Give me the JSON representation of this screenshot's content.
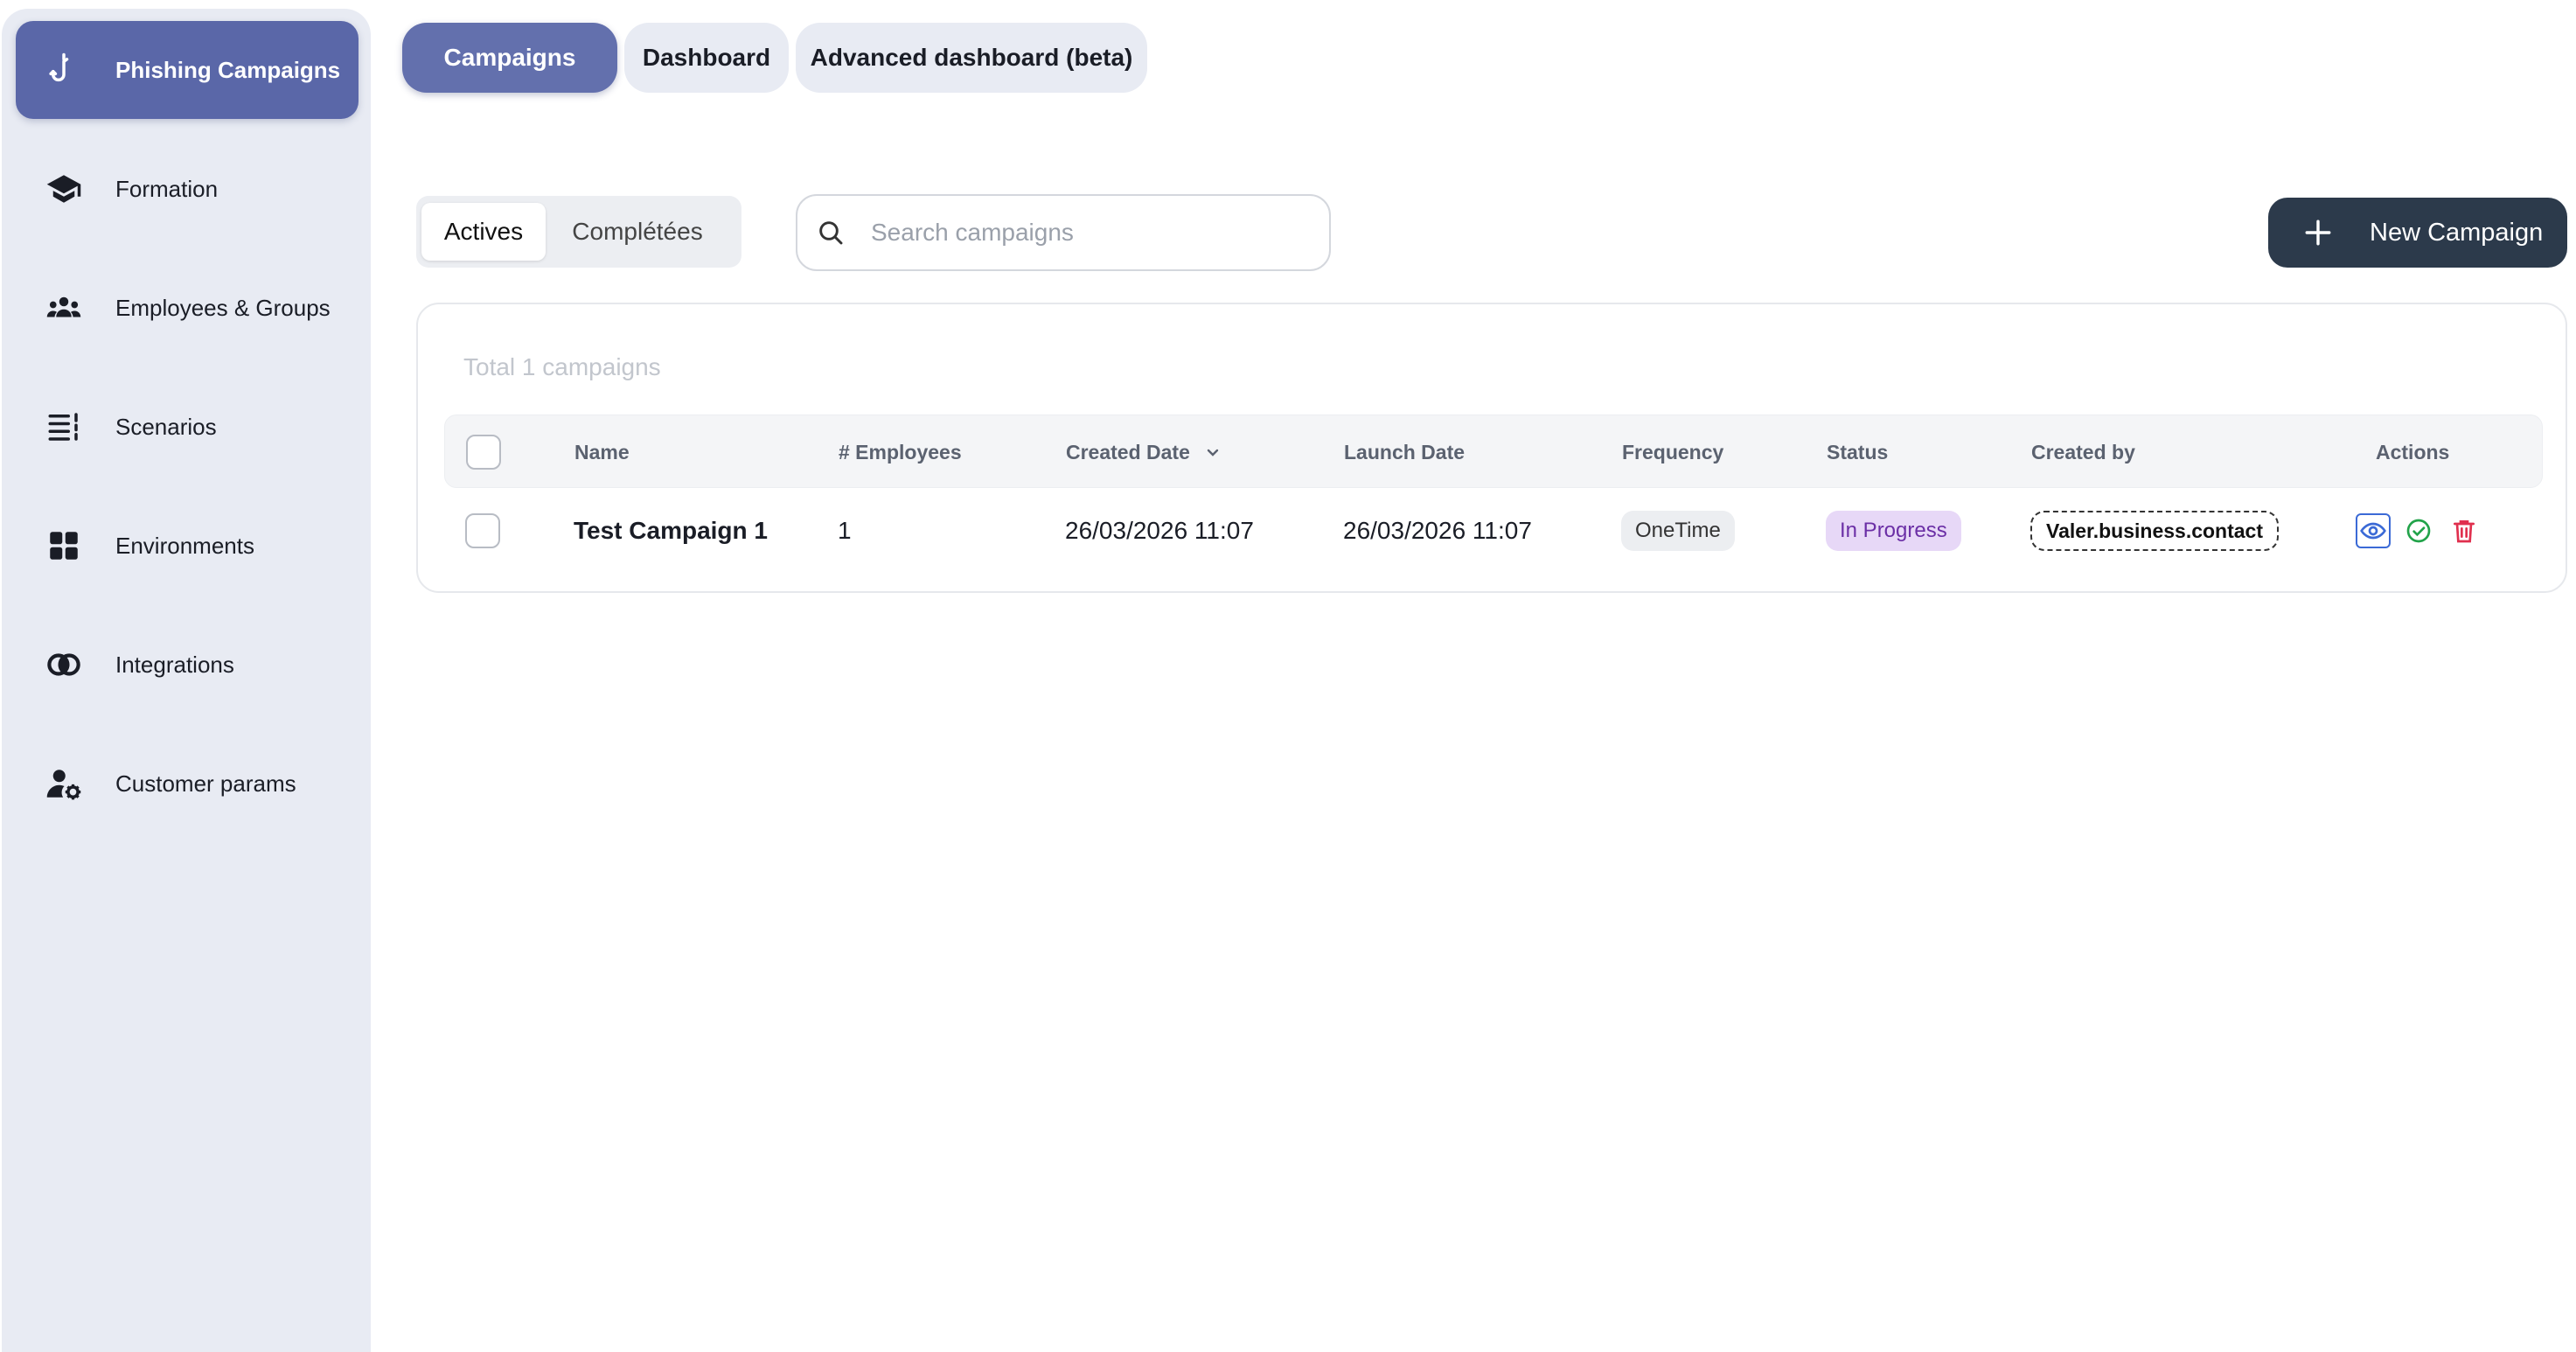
{
  "sidebar": {
    "items": [
      {
        "label": "Phishing Campaigns",
        "icon": "hook-icon",
        "active": true
      },
      {
        "label": "Formation",
        "icon": "graduation-cap-icon"
      },
      {
        "label": "Employees & Groups",
        "icon": "people-group-icon"
      },
      {
        "label": "Scenarios",
        "icon": "list-icon"
      },
      {
        "label": "Environments",
        "icon": "grid-icon"
      },
      {
        "label": "Integrations",
        "icon": "integration-rings-icon"
      },
      {
        "label": "Customer params",
        "icon": "user-gear-icon"
      }
    ]
  },
  "top_tabs": [
    {
      "label": "Campaigns",
      "active": true
    },
    {
      "label": "Dashboard"
    },
    {
      "label": "Advanced dashboard (beta)"
    }
  ],
  "filter": {
    "active_label": "Actives",
    "completed_label": "Complétées"
  },
  "search": {
    "placeholder": "Search campaigns",
    "icon": "search-icon"
  },
  "new_campaign": {
    "label": "New Campaign",
    "icon": "plus-icon"
  },
  "table": {
    "total_label": "Total 1 campaigns",
    "columns": {
      "name": "Name",
      "employees": "# Employees",
      "created": "Created Date",
      "launch": "Launch Date",
      "frequency": "Frequency",
      "status": "Status",
      "created_by": "Created by",
      "actions": "Actions"
    },
    "rows": [
      {
        "name": "Test Campaign 1",
        "employees": "1",
        "created": "26/03/2026 11:07",
        "launch": "26/03/2026 11:07",
        "frequency": "OneTime",
        "status": "In Progress",
        "created_by": "Valer.business.contact"
      }
    ]
  },
  "colors": {
    "accent": "#5a67a8",
    "sidebar_bg": "#e8ebf3",
    "primary_dark": "#2c3a4b",
    "status_bg": "#e7d8f7",
    "status_text": "#6b2fa6",
    "view_blue": "#3b6ad6",
    "complete_green": "#22a34a",
    "delete_red": "#e0304e"
  }
}
